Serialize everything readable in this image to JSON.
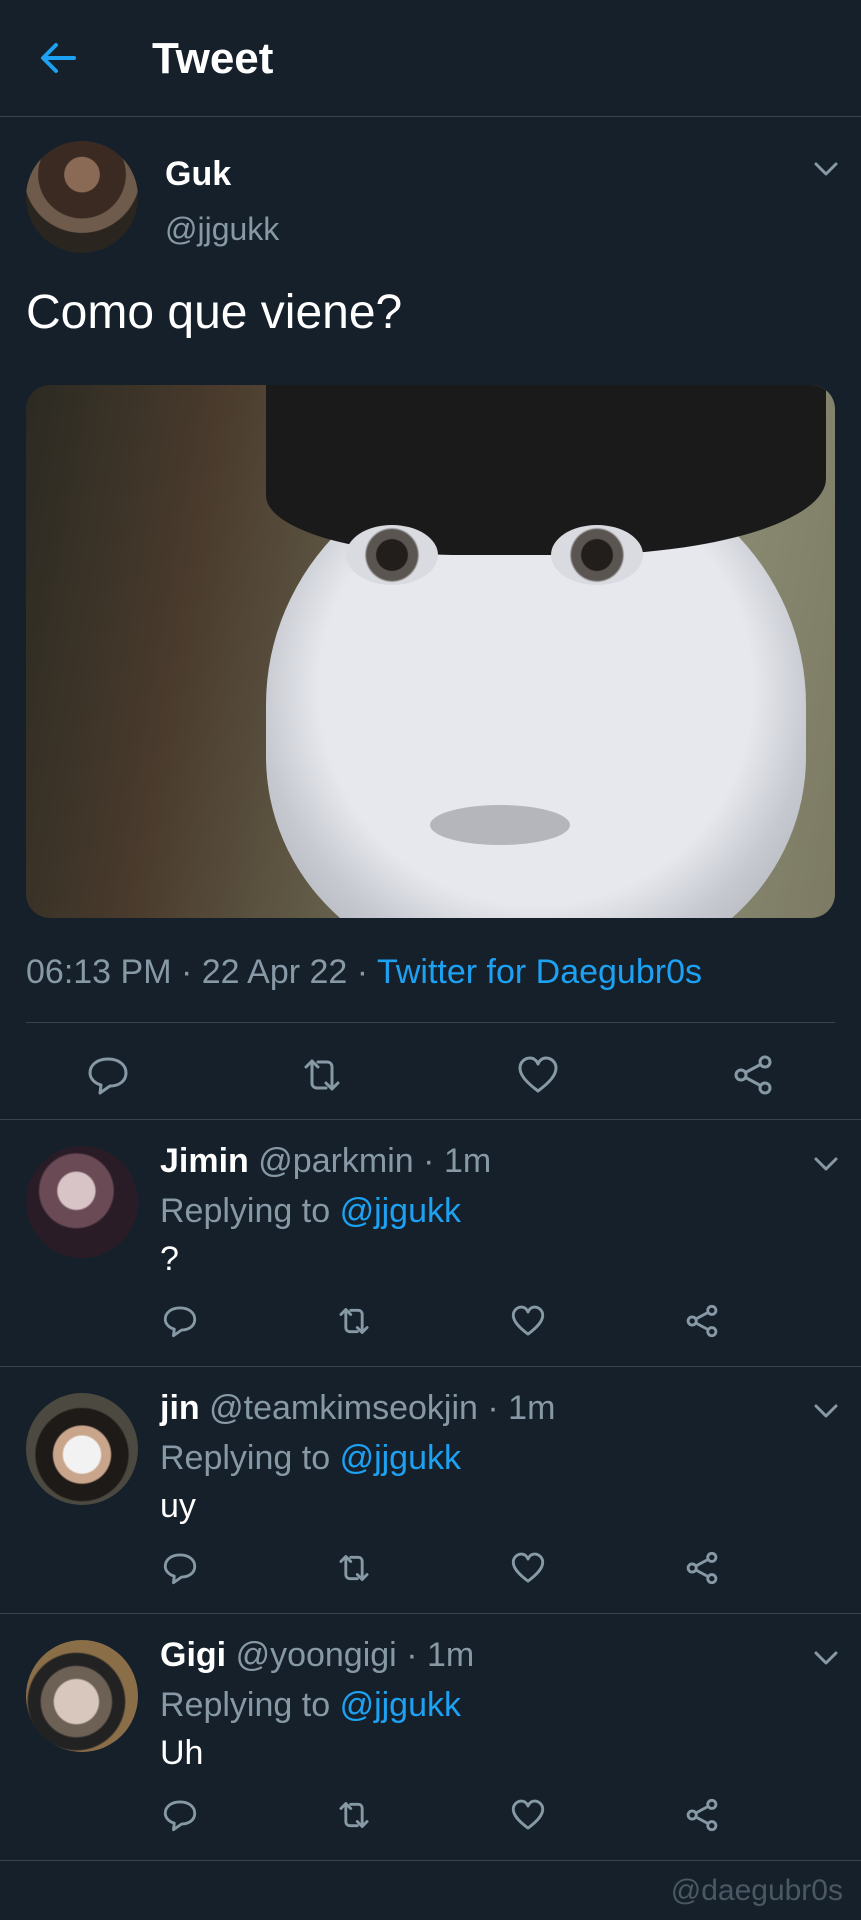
{
  "header": {
    "title": "Tweet",
    "back_icon": "arrow-left-icon",
    "accent": "#1da1f2"
  },
  "tweet": {
    "author": {
      "name": "Guk",
      "handle": "@jjgukk"
    },
    "text": "Como que viene?",
    "time": "06:13 PM",
    "date": "22 Apr 22",
    "separator": "·",
    "client": "Twitter for Daegubr0s",
    "actions": [
      "reply-icon",
      "retweet-icon",
      "like-icon",
      "share-icon"
    ]
  },
  "replies": [
    {
      "name": "Jimin",
      "handle": "@parkmin",
      "time": "1m",
      "replying_label": "Replying to",
      "mention": "@jjgukk",
      "text": "?"
    },
    {
      "name": "jin",
      "handle": "@teamkimseokjin",
      "time": "1m",
      "replying_label": "Replying to",
      "mention": "@jjgukk",
      "text": "uy"
    },
    {
      "name": "Gigi",
      "handle": "@yoongigi",
      "time": "1m",
      "replying_label": "Replying to",
      "mention": "@jjgukk",
      "text": "Uh"
    }
  ],
  "watermark": "@daegubr0s",
  "colors": {
    "background": "#15202b",
    "secondary_text": "#8899a6",
    "divider": "#38444d",
    "link": "#1da1f2"
  }
}
